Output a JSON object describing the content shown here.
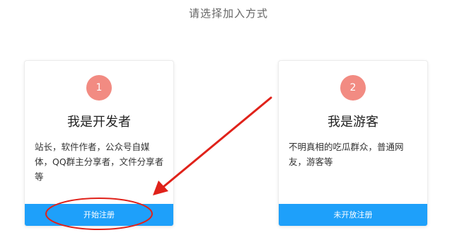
{
  "page": {
    "heading": "请选择加入方式"
  },
  "cards": [
    {
      "step": "1",
      "title": "我是开发者",
      "description": "站长，软件作者，公众号自媒体，QQ群主分享者，文件分享者等",
      "button_label": "开始注册"
    },
    {
      "step": "2",
      "title": "我是游客",
      "description": "不明真相的吃瓜群众，普通网友，游客等",
      "button_label": "未开放注册"
    }
  ],
  "colors": {
    "step_circle": "#f28b82",
    "button": "#1ea0fa",
    "annotation": "#e0221a"
  },
  "icons": {
    "arrow": "red-arrow-annotation",
    "ellipse": "red-ellipse-annotation"
  }
}
